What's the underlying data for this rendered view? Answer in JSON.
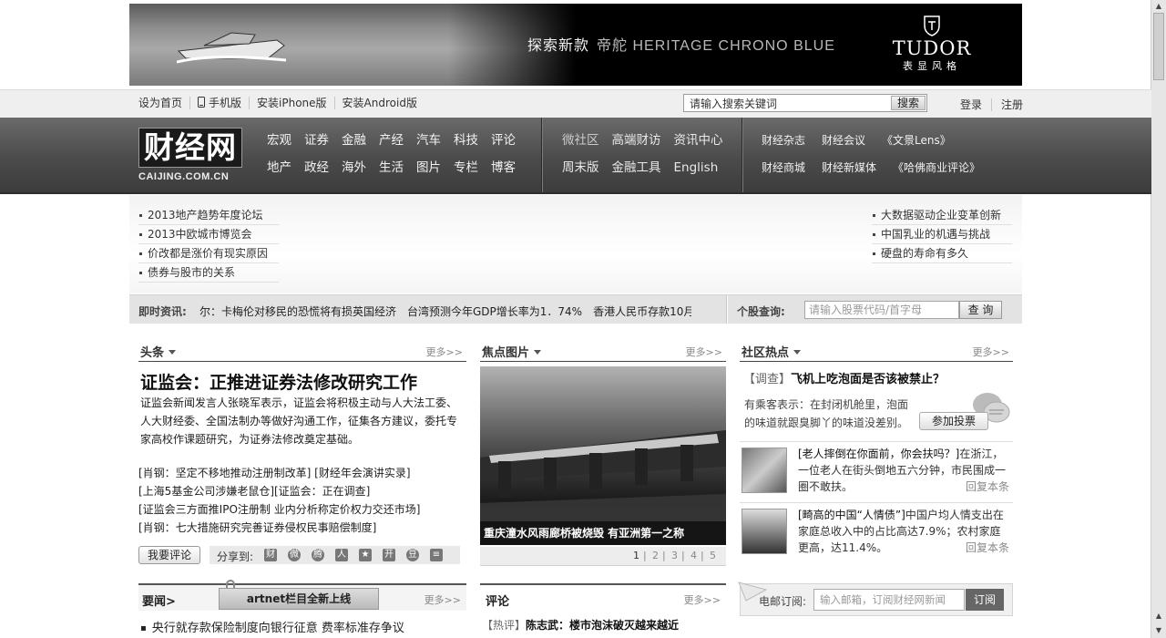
{
  "top_ad": {
    "slogan_cn": "探索新款",
    "slogan_en": "帝舵 HERITAGE CHRONO BLUE",
    "brand": "TUDOR",
    "brand_sub": "表显风格"
  },
  "utility_bar": {
    "links": [
      "设为首页",
      "手机版",
      "安装iPhone版",
      "安装Android版"
    ],
    "search_placeholder": "请输入搜索关键词",
    "search_button": "搜索",
    "login": "登录",
    "register": "注册"
  },
  "logo": {
    "cn": "财经网",
    "en": "CAIJING.COM.CN"
  },
  "nav": {
    "group1_row1": [
      "宏观",
      "证券",
      "金融",
      "产经",
      "汽车",
      "科技",
      "评论"
    ],
    "group1_row2": [
      "地产",
      "政经",
      "海外",
      "生活",
      "图片",
      "专栏",
      "博客"
    ],
    "group2_row1": [
      "微社区",
      "高端财访",
      "资讯中心"
    ],
    "group2_row2": [
      "周末版",
      "金融工具",
      "English"
    ],
    "group3_row1": [
      "财经杂志",
      "财经会议",
      "《文景Lens》"
    ],
    "group3_row2": [
      "财经商城",
      "财经新媒体",
      "《哈佛商业评论》"
    ]
  },
  "feature_links": {
    "left": [
      "2013地产趋势年度论坛",
      "2013中欧城市博览会",
      "价改都是涨价有现实原因",
      "债券与股市的关系"
    ],
    "right": [
      "大数据驱动企业变革创新",
      "中国乳业的机遇与挑战",
      "硬盘的寿命有多久"
    ]
  },
  "ticker": {
    "label": "即时资讯:",
    "news": "尔：卡梅伦对移民的恐慌将有损英国经济　台湾预测今年GDP增长率为1．74%　香港人民币存款10月份",
    "stock_label": "个股查询:",
    "stock_placeholder": "请输入股票代码/首字母",
    "stock_button": "查 询"
  },
  "headlines": {
    "title": "头条",
    "more": "更多>>",
    "main": "证监会：正推进证券法修改研究工作",
    "summary": "证监会新闻发言人张晓军表示，证监会将积极主动与人大法工委、人大财经委、全国法制办等做好沟通工作，征集各方建议，委托专家高校作课题研究，为证券法修改奠定基础。",
    "related": [
      "[肖钢：坚定不移地推动注册制改革] [财经年会演讲实录]",
      "[上海5基金公司涉嫌老鼠仓][证监会：正在调查]",
      "[证监会三方面推IPO注册制 业内分析称定价权力交还市场]",
      "[肖钢：七大措施研究完善证券侵权民事赔偿制度]"
    ],
    "comment_button": "我要评论",
    "share_label": "分享到:"
  },
  "focus_photo": {
    "title": "焦点图片",
    "more": "更多>>",
    "caption": "重庆潼水风雨廊桥被烧毁 有亚洲第一之称",
    "pages": [
      "1",
      "2",
      "3",
      "4",
      "5"
    ]
  },
  "community": {
    "title": "社区热点",
    "more": "更多>>",
    "poll_tag": "【调查】",
    "poll_question": "飞机上吃泡面是否该被禁止？",
    "poll_desc": "有乘客表示：在封闭机舱里，泡面的味道就跟臭脚丫的味道没差别。",
    "poll_button": "参加投票",
    "items": [
      {
        "bold": "[老人摔倒在你面前，你会扶吗？]",
        "text": "在浙江，一位老人在街头倒地五六分钟，市民围成一圈不敢扶。",
        "reply": "回复本条"
      },
      {
        "bold": "[畸高的中国“人情债”]",
        "text": "中国户均人情支出在家庭总收入中的占比高达7.9%；农村家庭更高，达11.4%。",
        "reply": "回复本条"
      }
    ]
  },
  "yaowen": {
    "title": "要闻>",
    "notice": "artnet栏目全新上线",
    "more": "更多>>",
    "item": "央行就存款保险制度向银行征意 费率标准存争议"
  },
  "pinglun": {
    "title": "评论",
    "more": "更多>>",
    "tag": "【热评】",
    "item": "陈志武：楼市泡沫破灭越来越近"
  },
  "subscribe": {
    "label": "电邮订阅:",
    "placeholder": "输入邮箱，订阅财经网新闻",
    "button": "订阅"
  }
}
